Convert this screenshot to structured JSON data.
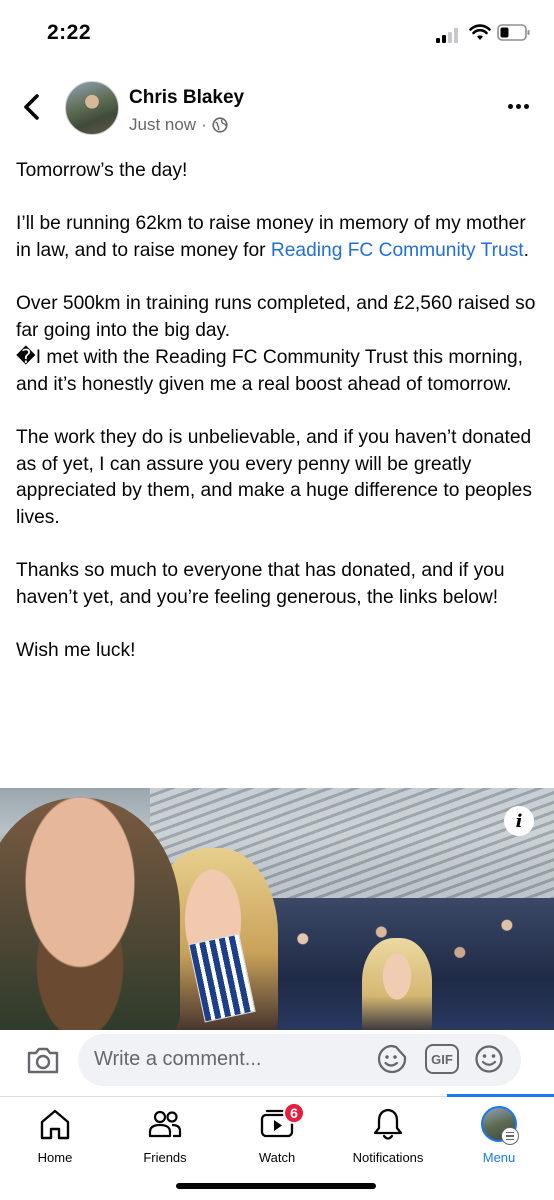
{
  "status_bar": {
    "time": "2:22"
  },
  "post": {
    "author": "Chris Blakey",
    "timestamp": "Just now",
    "separator": "·",
    "privacy_icon": "globe-icon",
    "body": {
      "line1": "Tomorrow’s the day!",
      "p2_before_link": "I’ll be running 62km to raise money in memory of my mother in law, and to raise money for ",
      "p2_link": "Reading FC Community Trust",
      "p2_after_link": ".",
      "p3_line1": "Over 500km in training runs completed, and £2,560 raised so far going into the big day.",
      "p3_glyph": "�",
      "p3_line2": "I met with the Reading FC Community Trust this morning, and it’s honestly given me a real boost ahead of tomorrow.",
      "p4": "The work they do is unbelievable, and if you haven’t donated as of yet, I can assure you every penny will be greatly appreciated by them, and make a huge difference to peoples lives.",
      "p5": "Thanks so much to everyone that has donated, and if you haven’t yet, and you’re feeling generous, the links below!",
      "p6": "Wish me luck!"
    },
    "photo_info_label": "i"
  },
  "comment_bar": {
    "placeholder": "Write a comment...",
    "gif_label": "GIF"
  },
  "tabs": [
    {
      "label": "Home",
      "icon": "home-icon",
      "active": false
    },
    {
      "label": "Friends",
      "icon": "friends-icon",
      "active": false
    },
    {
      "label": "Watch",
      "icon": "watch-icon",
      "active": false,
      "badge": "6"
    },
    {
      "label": "Notifications",
      "icon": "bell-icon",
      "active": false
    },
    {
      "label": "Menu",
      "icon": "menu-avatar",
      "active": true
    }
  ],
  "colors": {
    "accent": "#1877f2",
    "link": "#216fdb",
    "badge": "#e41e3f",
    "secondary_text": "#65676b"
  }
}
